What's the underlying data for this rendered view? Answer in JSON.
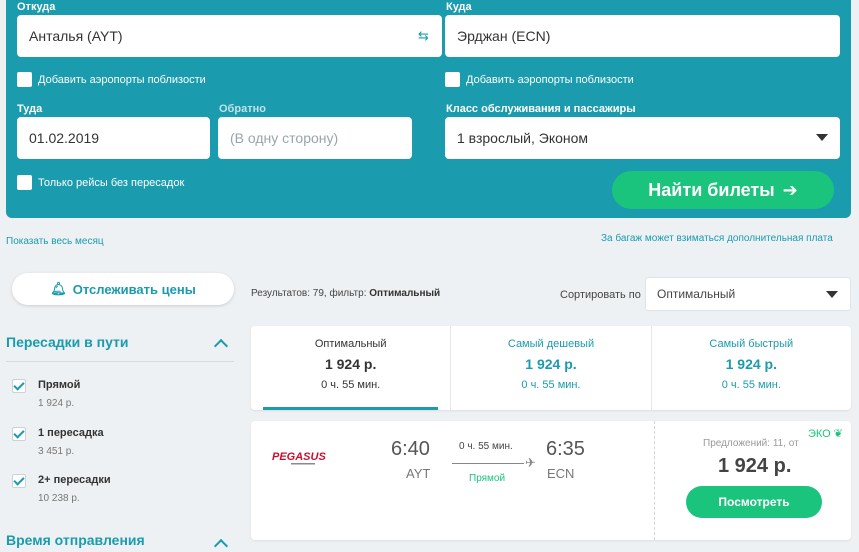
{
  "search": {
    "from_label": "Откуда",
    "from_value": "Анталья (AYT)",
    "to_label": "Куда",
    "to_value": "Эрджан (ECN)",
    "nearby_from": "Добавить аэропорты поблизости",
    "nearby_to": "Добавить аэропорты поблизости",
    "depart_label": "Туда",
    "depart_value": "01.02.2019",
    "return_label": "Обратно",
    "return_placeholder": "(В одну сторону)",
    "class_label": "Класс обслуживания и пассажиры",
    "class_value": "1 взрослый, Эконом",
    "direct_only": "Только рейсы без пересадок",
    "find_button": "Найти билеты"
  },
  "links": {
    "show_month": "Показать весь месяц",
    "baggage_note": "За багаж может взиматься дополнительная плата"
  },
  "sidebar": {
    "track_prices": "Отслеживать цены",
    "stops_title": "Пересадки в пути",
    "stops": [
      {
        "label": "Прямой",
        "price": "1 924 р."
      },
      {
        "label": "1 пересадка",
        "price": "3 451 р."
      },
      {
        "label": "2+ пересадки",
        "price": "10 238 р."
      }
    ],
    "departure_title": "Время отправления"
  },
  "results": {
    "summary_prefix": "Результатов: 79, фильтр: ",
    "summary_filter": "Оптимальный",
    "sort_label": "Сортировать по",
    "sort_value": "Оптимальный"
  },
  "tabs": [
    {
      "name": "Оптимальный",
      "price": "1 924 р.",
      "duration": "0 ч. 55 мин."
    },
    {
      "name": "Самый дешевый",
      "price": "1 924 р.",
      "duration": "0 ч. 55 мин."
    },
    {
      "name": "Самый быстрый",
      "price": "1 924 р.",
      "duration": "0 ч. 55 мин."
    }
  ],
  "flight": {
    "airline": "PEGASUS",
    "depart_time": "6:40",
    "depart_code": "AYT",
    "arrive_time": "6:35",
    "arrive_code": "ECN",
    "duration": "0 ч. 55 мин.",
    "route_type": "Прямой",
    "eco": "ЭКО",
    "offers": "Предложений: 11, от",
    "price": "1 924 р.",
    "view_button": "Посмотреть"
  },
  "colors": {
    "brand": "#1a9bae",
    "accent_green": "#1bc47d"
  }
}
